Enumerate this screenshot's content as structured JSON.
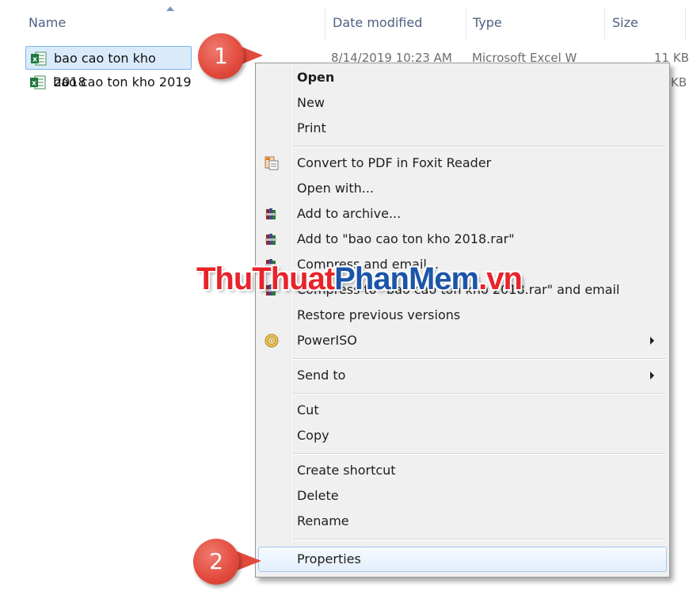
{
  "columns": {
    "name": "Name",
    "date_modified": "Date modified",
    "type": "Type",
    "size": "Size"
  },
  "files": [
    {
      "name": "bao cao ton kho 2018",
      "date": "8/14/2019 10:23 AM",
      "type": "Microsoft Excel W",
      "size": "11 KB",
      "selected": true,
      "icon": "excel-file-icon"
    },
    {
      "name": "bao cao ton kho 2019",
      "size": "KB",
      "selected": false,
      "icon": "excel-file-icon"
    }
  ],
  "menu": {
    "open": "Open",
    "new": "New",
    "print": "Print",
    "convert_pdf": "Convert to PDF in Foxit Reader",
    "open_with": "Open with...",
    "add_archive": "Add to archive...",
    "add_to_rar": "Add to \"bao cao ton kho 2018.rar\"",
    "compress_email": "Compress and email...",
    "compress_rar_email": "Compress to \"bao cao ton kho 2018.rar\" and email",
    "restore": "Restore previous versions",
    "poweriso": "PowerISO",
    "send_to": "Send to",
    "cut": "Cut",
    "copy": "Copy",
    "create_shortcut": "Create shortcut",
    "delete": "Delete",
    "rename": "Rename",
    "properties": "Properties"
  },
  "badges": {
    "step1": "1",
    "step2": "2"
  },
  "watermark": {
    "part1": "ThuThuat",
    "part2": "PhanMem",
    "part3": ".vn"
  },
  "colors": {
    "badge": "#e14a3c",
    "selection": "#d9ebfb",
    "watermark_red": "#e8232a",
    "watermark_blue": "#1c55a8"
  }
}
